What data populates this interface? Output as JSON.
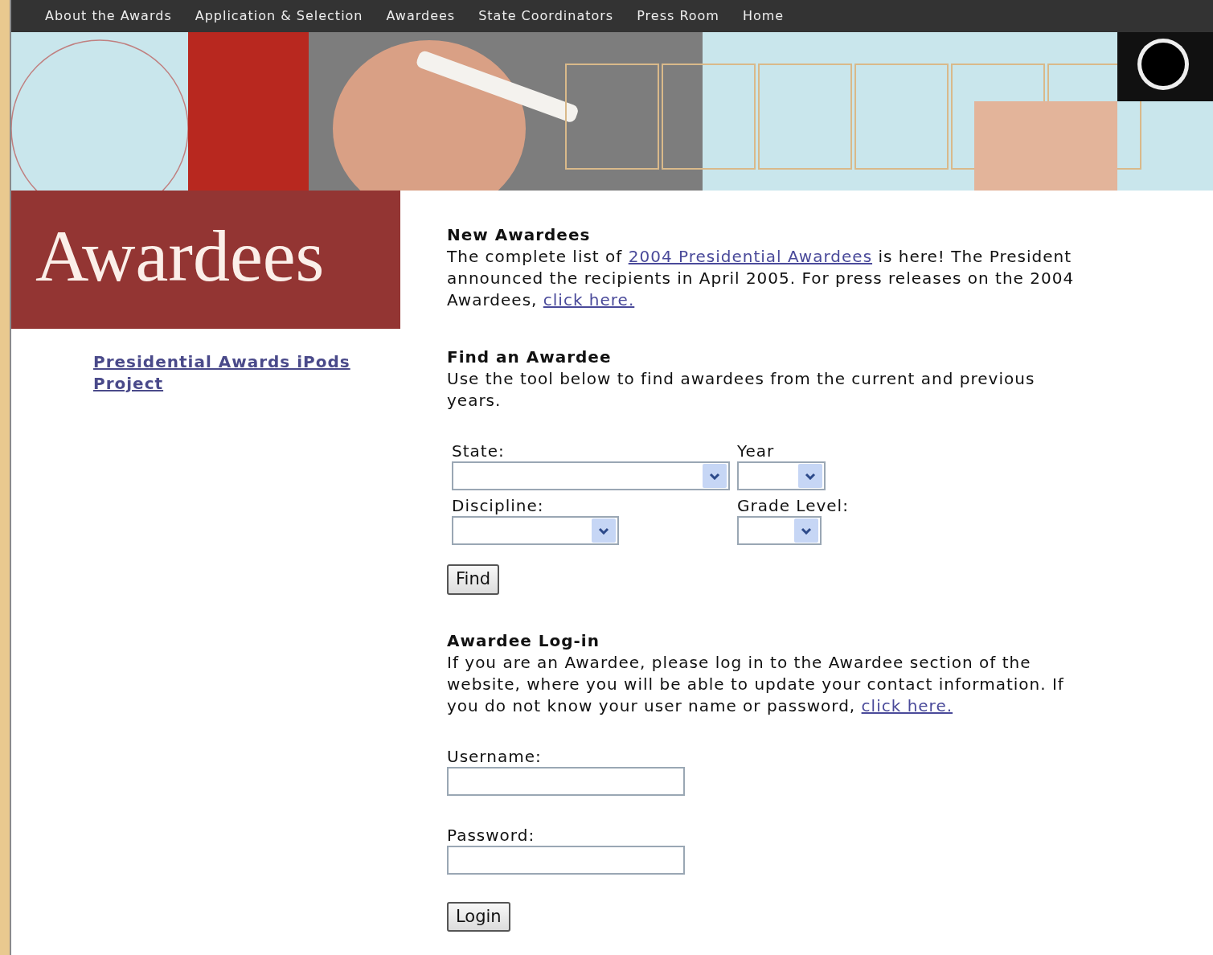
{
  "nav": [
    "About the Awards",
    "Application & Selection",
    "Awardees",
    "State Coordinators",
    "Press Room",
    "Home"
  ],
  "banner": {
    "kind": "picture"
  },
  "page_title": "Awardees",
  "sidebar_links": [
    "Presidential Awards iPods Project"
  ],
  "sections": [
    {
      "kind": "text",
      "heading": "New Awardees",
      "text": [
        {
          "t": "The complete list of "
        },
        {
          "link": "2004 Presidential Awardees"
        },
        {
          "t": " is here! The President announced the recipients in April 2005. For press releases on the 2004 Awardees, "
        },
        {
          "link": "click here."
        }
      ]
    },
    {
      "kind": "search",
      "heading": "Find an Awardee",
      "text": [
        {
          "t": "Use the tool below to find awardees from the current and previous years."
        }
      ],
      "fields": [
        {
          "label": "State:"
        },
        {
          "label": "Year"
        },
        {
          "label": "Discipline:"
        },
        {
          "label": "Grade Level:"
        }
      ],
      "button": "Find"
    },
    {
      "kind": "login",
      "heading": "Awardee Log-in",
      "text": [
        {
          "t": "If you are an Awardee, please log in to the Awardee section of the website, where you will be able to update your contact information. If you do not know your user name or password, "
        },
        {
          "link": "click here."
        }
      ],
      "fields": [
        {
          "label": "Username:"
        },
        {
          "label": "Password:"
        }
      ],
      "button": "Login"
    }
  ]
}
